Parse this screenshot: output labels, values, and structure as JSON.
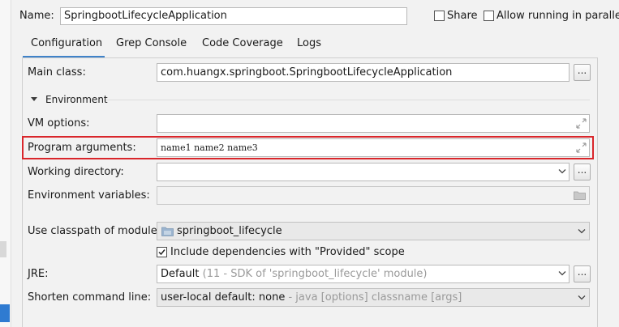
{
  "header": {
    "name_label": "Name:",
    "name_value": "SpringbootLifecycleApplication",
    "share_label": "Share",
    "allow_parallel_label": "Allow running in parallel"
  },
  "tabs": [
    {
      "label": "Configuration",
      "active": true
    },
    {
      "label": "Grep Console",
      "active": false
    },
    {
      "label": "Code Coverage",
      "active": false
    },
    {
      "label": "Logs",
      "active": false
    }
  ],
  "form": {
    "main_class_label": "Main class:",
    "main_class_value": "com.huangx.springboot.SpringbootLifecycleApplication",
    "browse_label": "...",
    "environment_label": "Environment",
    "vm_options_label": "VM options:",
    "vm_options_value": "",
    "program_args_label": "Program arguments:",
    "program_args_value": "name1 name2 name3",
    "working_dir_label": "Working directory:",
    "working_dir_value": "",
    "env_vars_label": "Environment variables:",
    "env_vars_value": "",
    "classpath_label": "Use classpath of module:",
    "classpath_value": "springboot_lifecycle",
    "include_deps_label": "Include dependencies with \"Provided\" scope",
    "include_deps_checked": true,
    "jre_label": "JRE:",
    "jre_value": "Default",
    "jre_hint": "(11 - SDK of 'springboot_lifecycle' module)",
    "shorten_label": "Shorten command line:",
    "shorten_value": "user-local default: none",
    "shorten_hint": "- java [options] classname [args]"
  },
  "colors": {
    "highlight_border": "#d9262b",
    "tab_underline": "#4083c9",
    "selection_blue": "#2f7bd1"
  }
}
